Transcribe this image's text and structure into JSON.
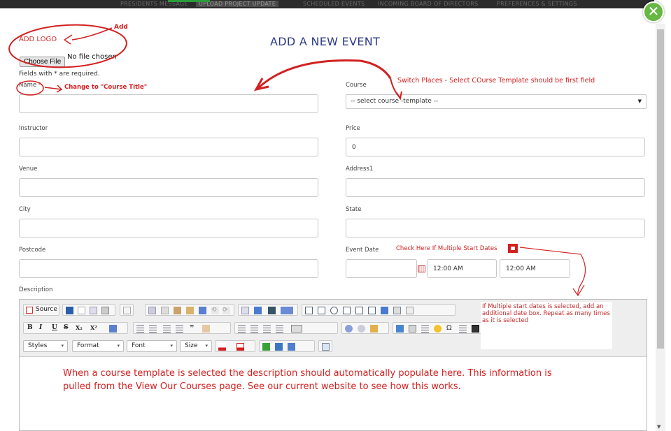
{
  "nav": {
    "tabs": [
      "PRESIDENTS MESSAGE",
      "UPLOAD PROJECT UPDATE",
      "SCHEDULED EVENTS",
      "INCOMING BOARD OF DIRECTORS",
      "PREFERENCES & SETTINGS"
    ],
    "active_index": 1
  },
  "close_button": "✕",
  "page_title": "ADD A NEW EVENT",
  "logo": {
    "label": "ADD LOGO",
    "choose_button": "Choose File",
    "status": "No file chosen"
  },
  "required_note": "Fields with * are required.",
  "fields": {
    "name": {
      "label": "Name *",
      "value": ""
    },
    "course": {
      "label": "Course",
      "selected": "-- select course -template --"
    },
    "instructor": {
      "label": "Instructor",
      "value": ""
    },
    "price": {
      "label": "Price",
      "value": "0"
    },
    "venue": {
      "label": "Venue",
      "value": ""
    },
    "address1": {
      "label": "Address1",
      "value": ""
    },
    "city": {
      "label": "City",
      "value": ""
    },
    "state": {
      "label": "State",
      "value": ""
    },
    "postcode": {
      "label": "Postcode",
      "value": ""
    },
    "event_date": {
      "label": "Event Date",
      "date": "",
      "start_time": "12:00 AM",
      "end_time": "12:00 AM"
    }
  },
  "description": {
    "label": "Description",
    "toolbar": {
      "source_label": "Source",
      "bold": "B",
      "italic": "I",
      "underline": "U",
      "strike": "S",
      "subscript": "X₂",
      "superscript": "X²",
      "combos": [
        "Styles",
        "Format",
        "Font",
        "Size"
      ]
    }
  },
  "annotations": {
    "add": "Add",
    "course_title": "Change to \"Course Title\"",
    "switch_places": "Switch Places - Select COurse Template should be first field",
    "multiple_dates": "Check Here If Multiple Start Dates",
    "multiple_note": "If Multiple start dates is selected, add an additional date box. Repeat as many times as it is selected",
    "description_note": "When a course template is selected the description should automatically populate here. This information is pulled from the View Our Courses page. See our current website to see how this works."
  },
  "colors": {
    "annotation_red": "#d32020",
    "title_blue": "#2e3a8c",
    "close_green": "#66b843"
  }
}
